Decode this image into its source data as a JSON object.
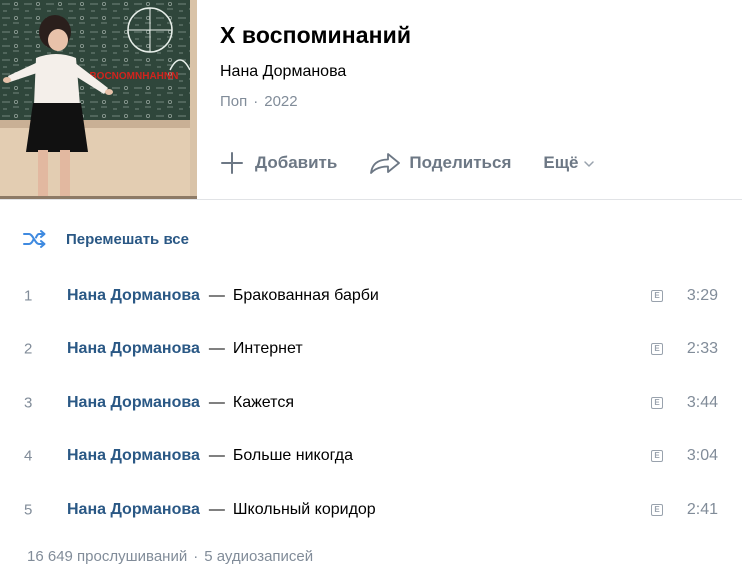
{
  "album": {
    "title": "X воспоминаний",
    "artist": "Нана Дорманова",
    "genre": "Поп",
    "year": "2022",
    "meta_separator": "·"
  },
  "actions": {
    "add_label": "Добавить",
    "share_label": "Поделиться",
    "more_label": "Ещё"
  },
  "shuffle": {
    "label": "Перемешать все"
  },
  "tracks": [
    {
      "num": "1",
      "artist": "Нана Дорманова",
      "separator": "—",
      "title": "Бракованная барби",
      "explicit": "E",
      "duration": "3:29"
    },
    {
      "num": "2",
      "artist": "Нана Дорманова",
      "separator": "—",
      "title": "Интернет",
      "explicit": "E",
      "duration": "2:33"
    },
    {
      "num": "3",
      "artist": "Нана Дорманова",
      "separator": "—",
      "title": "Кажется",
      "explicit": "E",
      "duration": "3:44"
    },
    {
      "num": "4",
      "artist": "Нана Дорманова",
      "separator": "—",
      "title": "Больше никогда",
      "explicit": "E",
      "duration": "3:04"
    },
    {
      "num": "5",
      "artist": "Нана Дорманова",
      "separator": "—",
      "title": "Школьный коридор",
      "explicit": "E",
      "duration": "2:41"
    }
  ],
  "footer": {
    "listens": "16 649 прослушиваний",
    "separator": "·",
    "tracks_count": "5 аудиозаписей"
  },
  "colors": {
    "link_blue": "#2a5885",
    "secondary_gray": "#818c99",
    "action_gray": "#6d7885",
    "divider": "#e1e3e6",
    "cover_chalkboard": "#2e4438"
  },
  "icons": {
    "add": "plus-icon",
    "share": "share-arrow-icon",
    "more": "chevron-down-icon",
    "shuffle": "shuffle-icon",
    "explicit": "explicit-icon"
  }
}
